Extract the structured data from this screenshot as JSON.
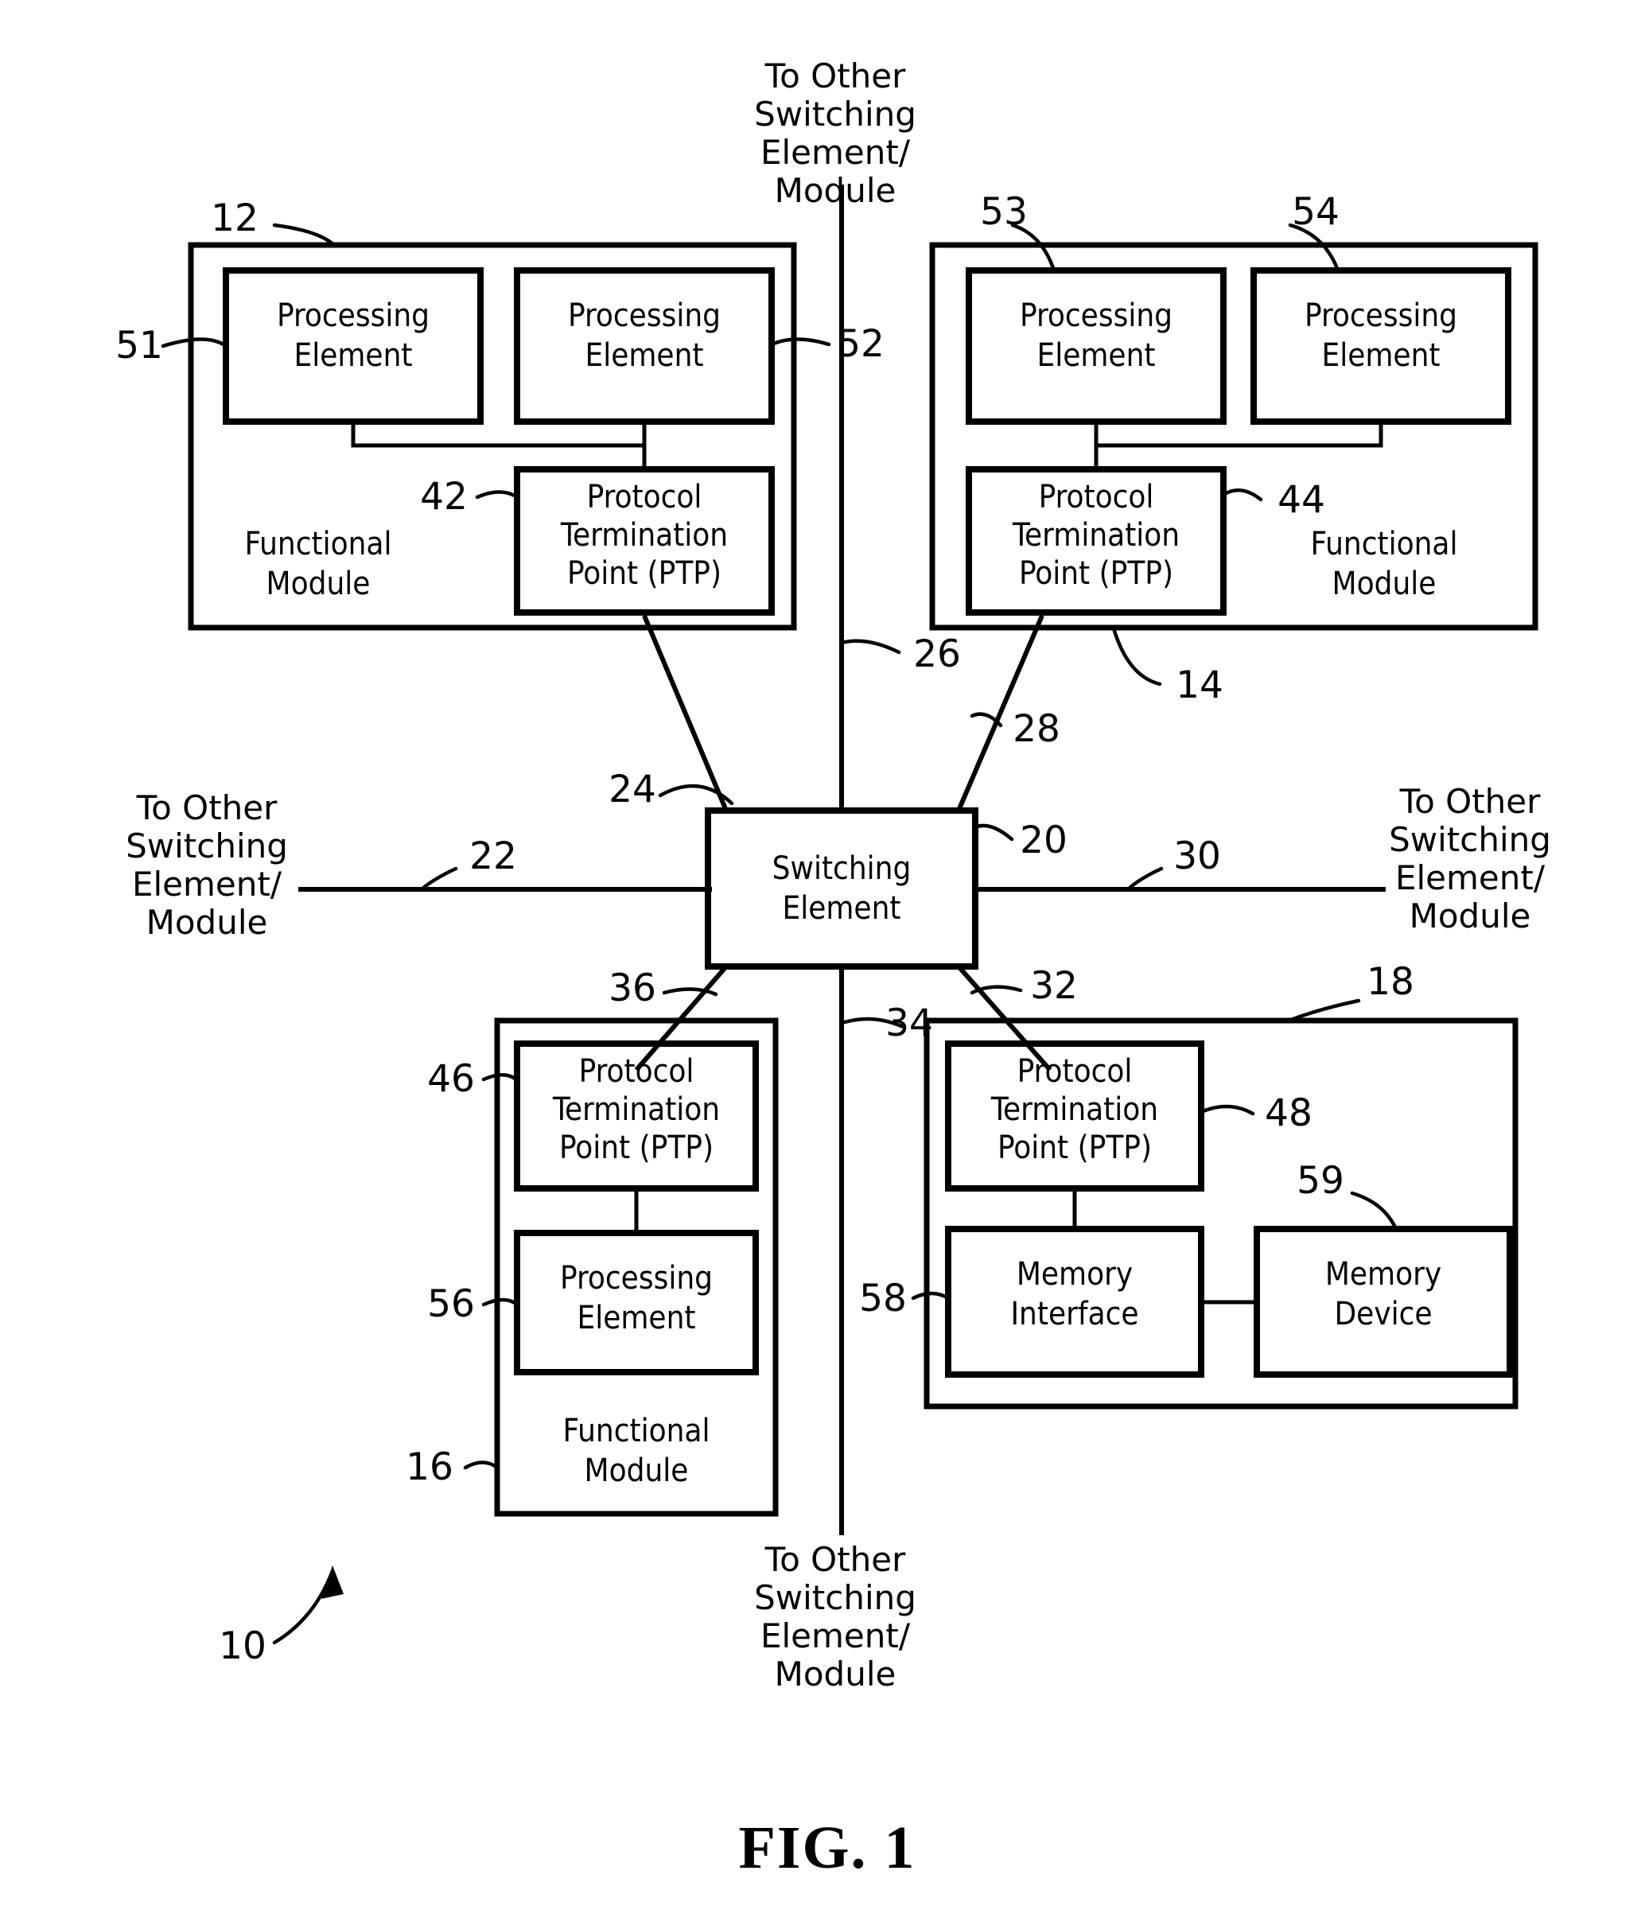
{
  "figure": {
    "caption": "FIG. 1",
    "system_ref": "10"
  },
  "labels": {
    "processing_element": "Processing\nElement",
    "ptp": "Protocol\nTermination\nPoint (PTP)",
    "functional_module": "Functional\nModule",
    "switching_element": "Switching\nElement",
    "memory_interface": "Memory\nInterface",
    "memory_device": "Memory\nDevice",
    "to_other": "To Other\nSwitching\nElement/\nModule"
  },
  "modules": {
    "top_left": {
      "ref": "12",
      "module_label": "Functional\nModule",
      "pe_left": {
        "ref": "51",
        "label": "Processing\nElement"
      },
      "pe_right": {
        "ref": "52",
        "label": "Processing\nElement"
      },
      "ptp": {
        "ref": "42",
        "label": "Protocol\nTermination\nPoint (PTP)"
      }
    },
    "top_right": {
      "ref": "14",
      "module_label": "Functional\nModule",
      "pe_left": {
        "ref": "53",
        "label": "Processing\nElement"
      },
      "pe_right": {
        "ref": "54",
        "label": "Processing\nElement"
      },
      "ptp": {
        "ref": "44",
        "label": "Protocol\nTermination\nPoint (PTP)"
      }
    },
    "bottom_left": {
      "ref": "16",
      "module_label": "Functional\nModule",
      "ptp": {
        "ref": "46",
        "label": "Protocol\nTermination\nPoint (PTP)"
      },
      "pe": {
        "ref": "56",
        "label": "Processing\nElement"
      }
    },
    "bottom_right": {
      "ref": "18",
      "ptp": {
        "ref": "48",
        "label": "Protocol\nTermination\nPoint (PTP)"
      },
      "memory_interface": {
        "ref": "58",
        "label": "Memory\nInterface"
      },
      "memory_device": {
        "ref": "59",
        "label": "Memory\nDevice"
      }
    },
    "center": {
      "ref": "20",
      "label": "Switching\nElement"
    }
  },
  "links": {
    "west": {
      "ref": "22",
      "note": "To Other\nSwitching\nElement/\nModule"
    },
    "northwest": {
      "ref": "24"
    },
    "north": {
      "ref": "26",
      "note": "To Other\nSwitching\nElement/\nModule"
    },
    "northeast": {
      "ref": "28"
    },
    "east": {
      "ref": "30",
      "note": "To Other\nSwitching\nElement/\nModule"
    },
    "southeast": {
      "ref": "32"
    },
    "south": {
      "ref": "34",
      "note": "To Other\nSwitching\nElement/\nModule"
    },
    "southwest": {
      "ref": "36"
    }
  },
  "ref_numbers": {
    "n10": "10",
    "n12": "12",
    "n14": "14",
    "n16": "16",
    "n18": "18",
    "n20": "20",
    "n22": "22",
    "n24": "24",
    "n26": "26",
    "n28": "28",
    "n30": "30",
    "n32": "32",
    "n34": "34",
    "n36": "36",
    "n42": "42",
    "n44": "44",
    "n46": "46",
    "n48": "48",
    "n51": "51",
    "n52": "52",
    "n53": "53",
    "n54": "54",
    "n56": "56",
    "n58": "58",
    "n59": "59"
  }
}
